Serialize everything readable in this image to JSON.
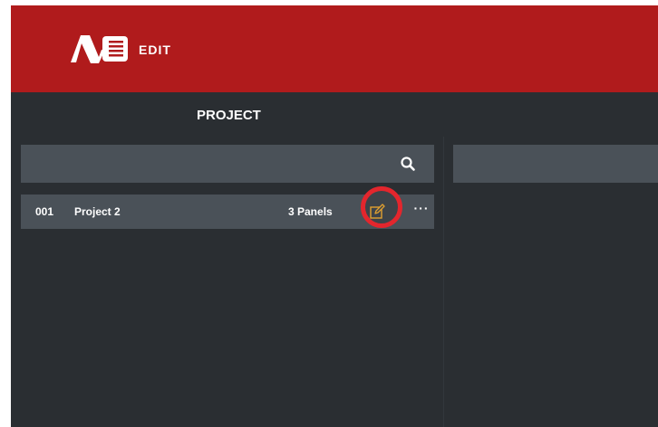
{
  "header": {
    "app_title": "EDIT",
    "brand_color": "#b01b1c",
    "logo_icon": "nb-logo-icon"
  },
  "page": {
    "title": "PROJECT"
  },
  "search": {
    "value": "",
    "placeholder": "",
    "icon": "search-icon"
  },
  "projects": [
    {
      "number": "001",
      "name": "Project 2",
      "panels": "3 Panels",
      "edit_icon": "edit-icon",
      "edit_icon_color": "#e0a030",
      "highlight_color": "#e3262d",
      "more_icon": "more-horizontal-icon",
      "more_label": "···"
    }
  ]
}
